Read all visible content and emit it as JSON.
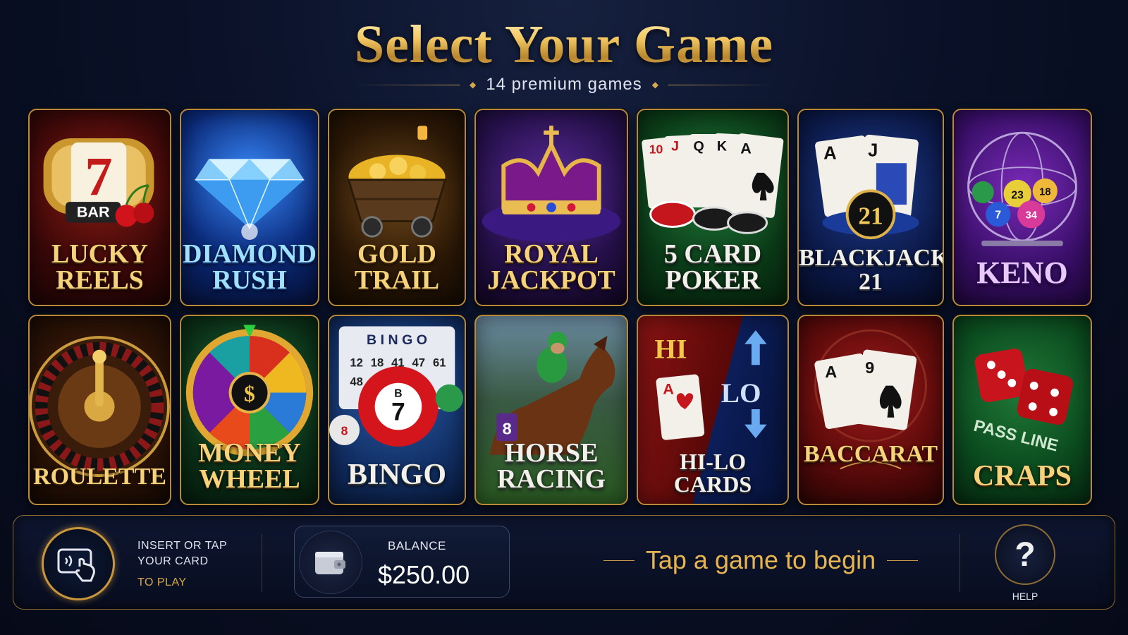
{
  "header": {
    "title": "Select Your Game",
    "subtitle": "14 premium games"
  },
  "games": [
    {
      "label": "LUCKY\nREELS",
      "icon": "slot-machine-icon"
    },
    {
      "label": "DIAMOND\nRUSH",
      "icon": "diamond-icon"
    },
    {
      "label": "GOLD\nTRAIL",
      "icon": "gold-cart-icon"
    },
    {
      "label": "ROYAL\nJACKPOT",
      "icon": "crown-icon"
    },
    {
      "label": "5 CARD\nPOKER",
      "icon": "poker-cards-icon"
    },
    {
      "label": "BLACKJACK\n21",
      "icon": "blackjack-cards-icon"
    },
    {
      "label": "KENO",
      "icon": "keno-cage-icon"
    },
    {
      "label": "ROULETTE",
      "icon": "roulette-wheel-icon"
    },
    {
      "label": "MONEY\nWHEEL",
      "icon": "money-wheel-icon"
    },
    {
      "label": "BINGO",
      "icon": "bingo-ball-icon"
    },
    {
      "label": "HORSE\nRACING",
      "icon": "horse-icon"
    },
    {
      "label": "HI-LO\nCARDS",
      "icon": "hi-lo-icon"
    },
    {
      "label": "BACCARAT",
      "icon": "baccarat-cards-icon"
    },
    {
      "label": "CRAPS",
      "icon": "dice-icon"
    }
  ],
  "art_text": {
    "bar": "BAR",
    "seven": "7",
    "bingo_header": "B I N G O",
    "bingo_numbers": [
      "12",
      "18",
      "41",
      "47",
      "61",
      "48"
    ],
    "bingo_ball_letter": "B",
    "bingo_ball_number": "7",
    "horse_number": "8",
    "hi": "HI",
    "lo": "LO",
    "blackjack_chip": "21",
    "pass_line": "PASS LINE",
    "keno_balls": [
      "23",
      "18",
      "7",
      "34"
    ],
    "dollar": "$",
    "card_A": "A",
    "card_J": "J",
    "card_9": "9",
    "card_10": "10",
    "card_Q": "Q",
    "card_K": "K"
  },
  "bottom_bar": {
    "insert_line1": "INSERT OR TAP",
    "insert_line2": "YOUR CARD",
    "insert_line3": "TO PLAY",
    "balance_label": "BALANCE",
    "balance_value": "$250.00",
    "prompt": "Tap a game to begin",
    "help_symbol": "?",
    "help_label": "HELP"
  },
  "colors": {
    "accent_gold": "#e6b451",
    "background": "#0a1128"
  }
}
